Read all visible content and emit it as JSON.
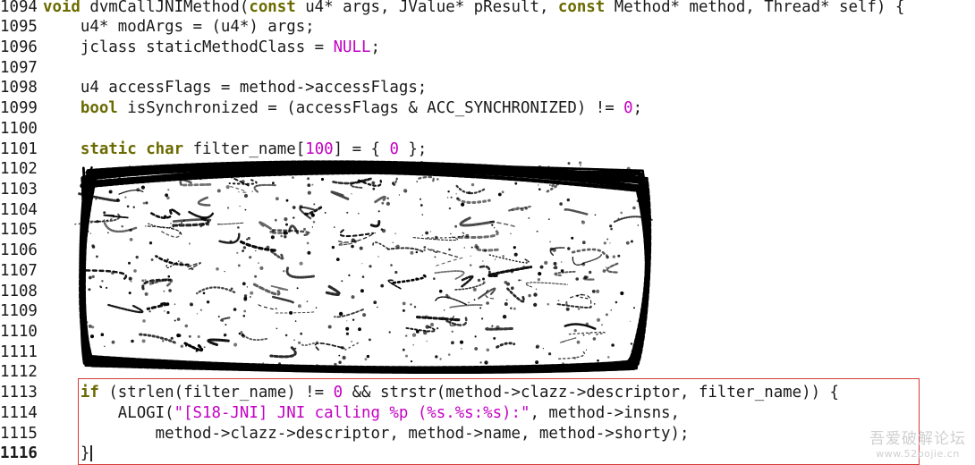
{
  "editor": {
    "lines": [
      {
        "num": "1094",
        "tokens": [
          [
            "kw",
            "void"
          ],
          [
            "t",
            " dvmCallJNIMethod("
          ],
          [
            "kw",
            "const"
          ],
          [
            "t",
            " u4* args, JValue* pResult, "
          ],
          [
            "kw",
            "const"
          ],
          [
            "t",
            " Method* method, Thread* self) {"
          ]
        ]
      },
      {
        "num": "1095",
        "tokens": [
          [
            "t",
            "    u4* modArgs = (u4*) args;"
          ]
        ]
      },
      {
        "num": "1096",
        "tokens": [
          [
            "t",
            "    jclass staticMethodClass = "
          ],
          [
            "nul",
            "NULL"
          ],
          [
            "t",
            ";"
          ]
        ]
      },
      {
        "num": "1097",
        "tokens": []
      },
      {
        "num": "1098",
        "tokens": [
          [
            "t",
            "    u4 accessFlags = method->accessFlags;"
          ]
        ]
      },
      {
        "num": "1099",
        "tokens": [
          [
            "t",
            "    "
          ],
          [
            "kw",
            "bool"
          ],
          [
            "t",
            " isSynchronized = (accessFlags & ACC_SYNCHRONIZED) != "
          ],
          [
            "num",
            "0"
          ],
          [
            "t",
            ";"
          ]
        ]
      },
      {
        "num": "1100",
        "tokens": []
      },
      {
        "num": "1101",
        "tokens": [
          [
            "t",
            "    "
          ],
          [
            "kw",
            "static"
          ],
          [
            "t",
            " "
          ],
          [
            "kw",
            "char"
          ],
          [
            "t",
            " filter_name["
          ],
          [
            "num",
            "100"
          ],
          [
            "t",
            "] = { "
          ],
          [
            "num",
            "0"
          ],
          [
            "t",
            " };"
          ]
        ]
      },
      {
        "num": "1102",
        "tokens": []
      },
      {
        "num": "1103",
        "tokens": []
      },
      {
        "num": "1104",
        "tokens": []
      },
      {
        "num": "1105",
        "tokens": []
      },
      {
        "num": "1106",
        "tokens": []
      },
      {
        "num": "1107",
        "tokens": []
      },
      {
        "num": "1108",
        "tokens": []
      },
      {
        "num": "1109",
        "tokens": []
      },
      {
        "num": "1110",
        "tokens": []
      },
      {
        "num": "1111",
        "tokens": []
      },
      {
        "num": "1112",
        "tokens": []
      },
      {
        "num": "1113",
        "tokens": [
          [
            "t",
            "    "
          ],
          [
            "kw",
            "if"
          ],
          [
            "t",
            " (strlen(filter_name) != "
          ],
          [
            "num",
            "0"
          ],
          [
            "t",
            " && strstr(method->clazz->descriptor, filter_name)) {"
          ]
        ]
      },
      {
        "num": "1114",
        "tokens": [
          [
            "t",
            "        ALOGI("
          ],
          [
            "str",
            "\"[S18-JNI] JNI calling %p (%s.%s:%s):\""
          ],
          [
            "t",
            ", method->insns,"
          ]
        ]
      },
      {
        "num": "1115",
        "tokens": [
          [
            "t",
            "            method->clazz->descriptor, method->name, method->shorty);"
          ]
        ]
      },
      {
        "num": "1116",
        "tokens": [
          [
            "t",
            "    }"
          ]
        ]
      }
    ],
    "current_line": "1116"
  },
  "colors": {
    "keyword": "#6a6a00",
    "literal": "#c400c4",
    "highlight_box": "#d63a3a",
    "scribble": "#000000"
  },
  "watermark": {
    "title": "吾爱破解论坛",
    "url": "www.52pojie.cn"
  }
}
